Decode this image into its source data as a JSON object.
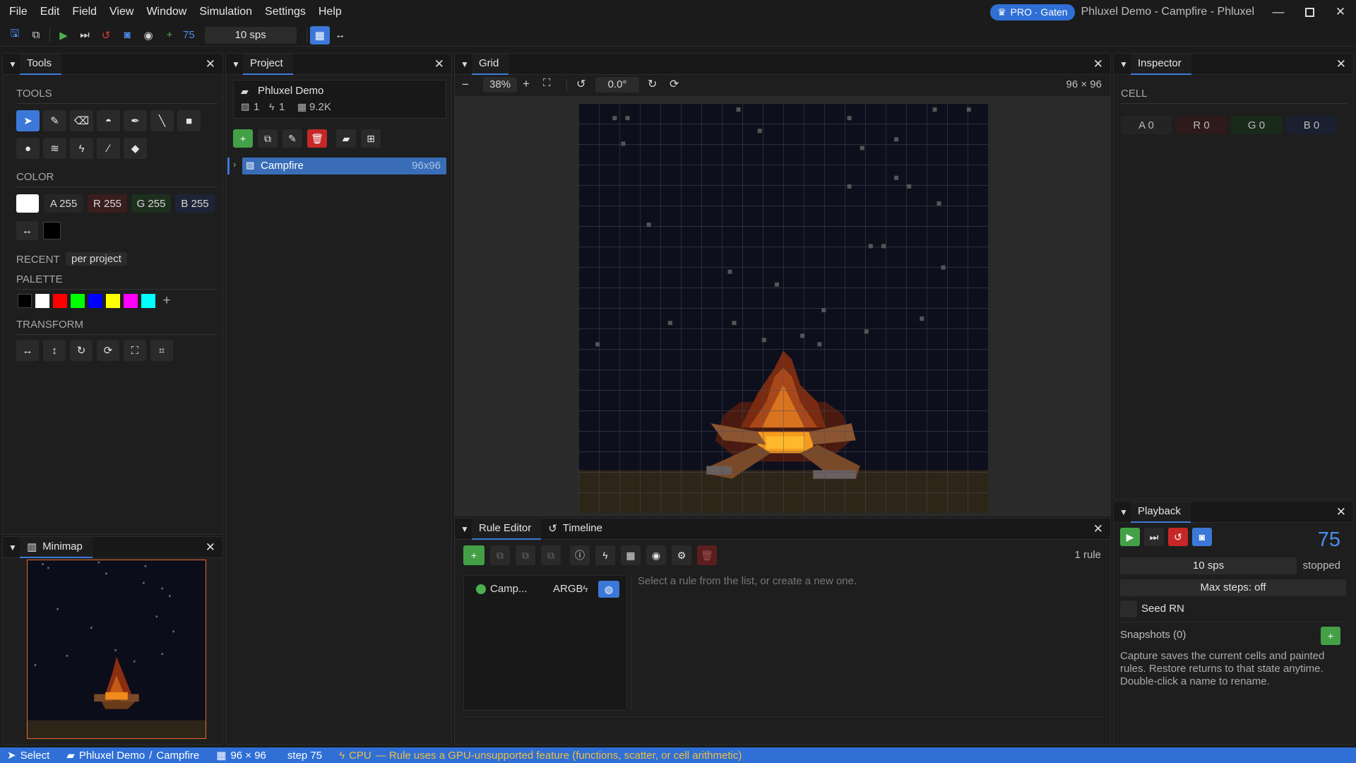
{
  "menubar": {
    "items": [
      "File",
      "Edit",
      "Field",
      "View",
      "Window",
      "Simulation",
      "Settings",
      "Help"
    ]
  },
  "titlebar": {
    "pro_label": "PRO · Gaten",
    "window_title": "Phluxel Demo - Campfire - Phluxel"
  },
  "toolbar": {
    "step_count": "75",
    "sps": "10 sps"
  },
  "tools_panel": {
    "tab_label": "Tools",
    "tools_header": "TOOLS",
    "color_header": "COLOR",
    "channels": {
      "a": "A 255",
      "r": "R 255",
      "g": "G 255",
      "b": "B 255"
    },
    "recent_label": "RECENT",
    "recent_mode": "per project",
    "palette_header": "PALETTE",
    "palette_colors": [
      "#000000",
      "#ffffff",
      "#ff0000",
      "#00ff00",
      "#0000ff",
      "#ffff00",
      "#ff00ff",
      "#00ffff"
    ],
    "transform_header": "TRANSFORM"
  },
  "minimap_panel": {
    "tab_label": "Minimap"
  },
  "project_panel": {
    "tab_label": "Project",
    "project_name": "Phluxel Demo",
    "stats": {
      "images": "1",
      "rules": "1",
      "cells": "9.2K"
    },
    "tree": [
      {
        "name": "Campfire",
        "size": "96x96"
      }
    ]
  },
  "grid_panel": {
    "tab_label": "Grid",
    "zoom": "38%",
    "rotation": "0.0°",
    "dimensions": "96 × 96"
  },
  "rule_editor": {
    "tab_label": "Rule Editor",
    "timeline_label": "Timeline",
    "rule_count": "1 rule",
    "rule_name": "Camp...",
    "rule_channels": "ARGB",
    "empty_message": "Select a rule from the list, or create a new one."
  },
  "inspector": {
    "tab_label": "Inspector",
    "cell_label": "CELL",
    "a": "A 0",
    "r": "R 0",
    "g": "G 0",
    "b": "B 0"
  },
  "playback": {
    "tab_label": "Playback",
    "step_count": "75",
    "sps": "10 sps",
    "state": "stopped",
    "max_steps": "Max steps: off",
    "seed": "Seed RN",
    "snapshots": "Snapshots (0)",
    "help": "Capture saves the current cells and painted rules. Restore returns to that state anytime. Double-click a name to rename."
  },
  "statusbar": {
    "tool": "Select",
    "project": "Phluxel Demo",
    "sep": "/",
    "image": "Campfire",
    "dims": "96 × 96",
    "step": "step 75",
    "backend": "CPU",
    "warning": "— Rule uses a GPU-unsupported feature (functions, scatter, or cell arithmetic)"
  },
  "colors": {
    "accent": "#3c78d8",
    "green": "#43a047",
    "red": "#c62828",
    "status_bg": "#2f6fd6",
    "warn": "#f0c040"
  }
}
